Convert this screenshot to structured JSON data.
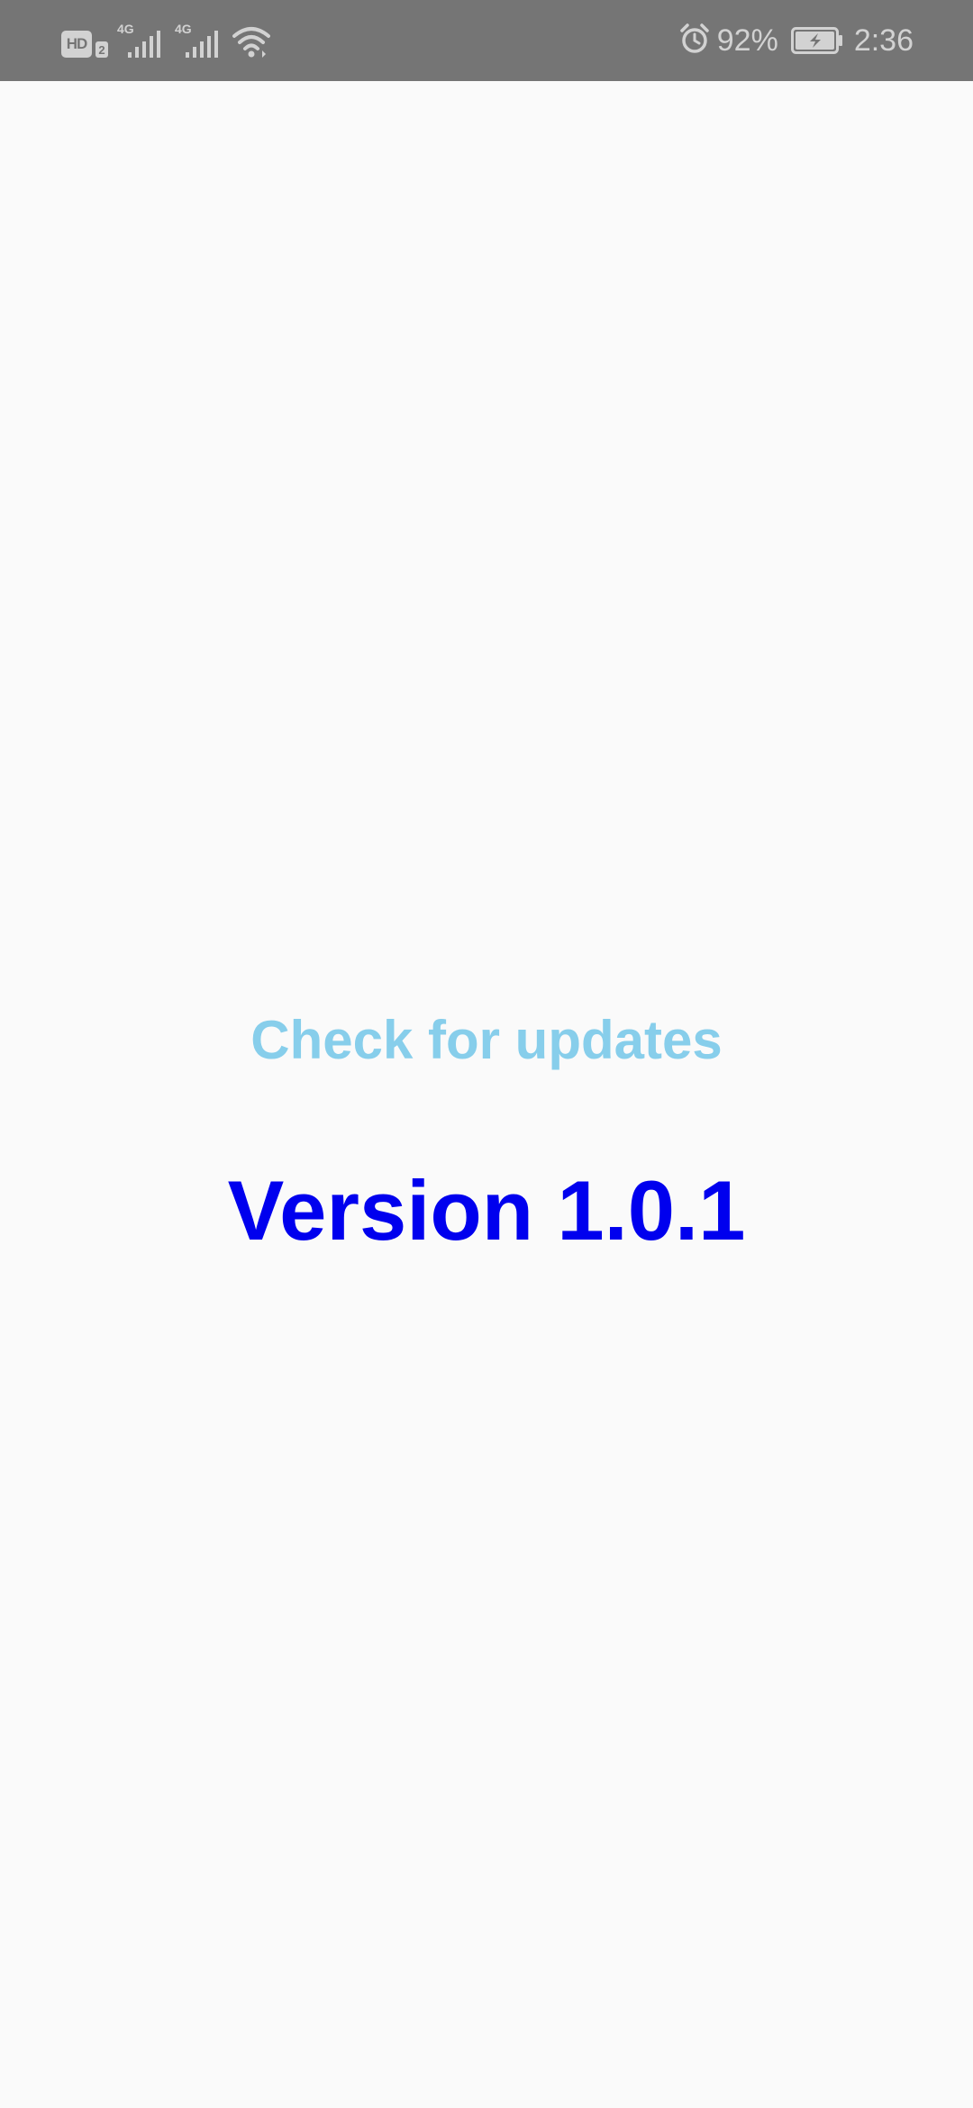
{
  "status_bar": {
    "hd_label": "HD",
    "sim_number": "2",
    "network_1": "4G",
    "network_2": "4G",
    "battery_percent": "92%",
    "time": "2:36",
    "icons": [
      "hd-icon",
      "signal-icon",
      "signal-icon",
      "wifi-icon",
      "alarm-icon",
      "battery-charging-icon"
    ]
  },
  "main": {
    "check_updates_label": "Check for updates",
    "version_text": "Version 1.0.1"
  },
  "colors": {
    "status_bar_bg": "#757575",
    "background": "#fafafa",
    "link": "#87ceeb",
    "version": "#0000ee"
  }
}
